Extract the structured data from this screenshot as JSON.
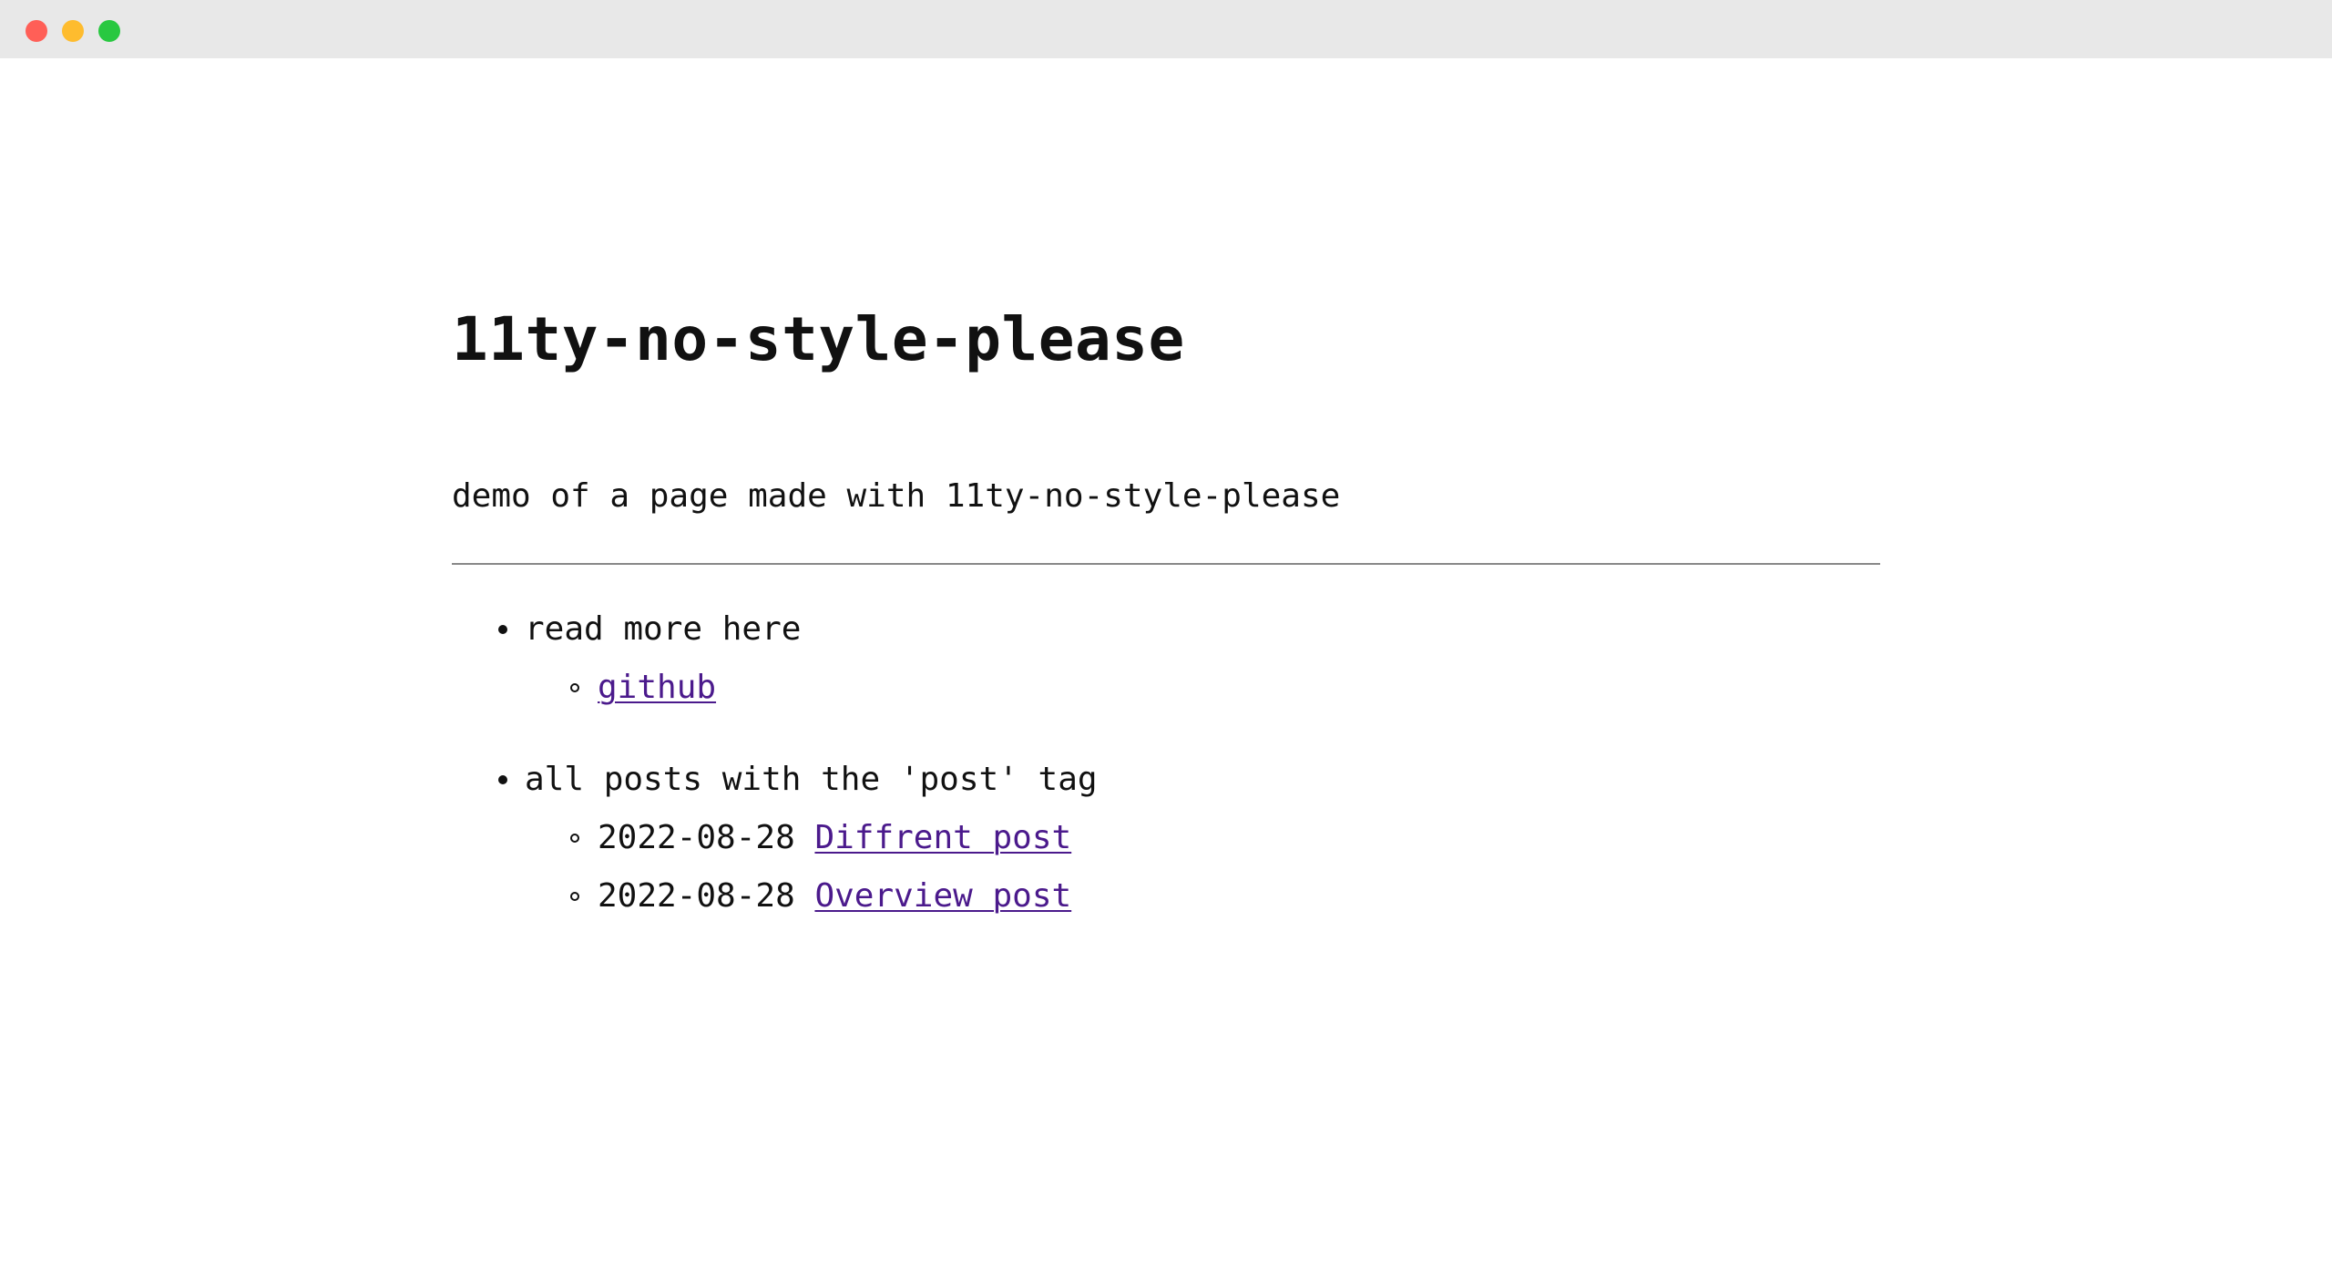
{
  "window": {
    "controls": [
      "close",
      "minimize",
      "maximize"
    ]
  },
  "page": {
    "title": "11ty-no-style-please",
    "subtitle": "demo of a page made with 11ty-no-style-please"
  },
  "sections": [
    {
      "label": "read more here",
      "items": [
        {
          "date": "",
          "link_text": "github"
        }
      ]
    },
    {
      "label": "all posts with the 'post' tag",
      "items": [
        {
          "date": "2022-08-28",
          "link_text": "Diffrent post"
        },
        {
          "date": "2022-08-28",
          "link_text": "Overview post"
        }
      ]
    }
  ],
  "colors": {
    "link": "#4b1a8c",
    "text": "#111111",
    "titlebar": "#e8e8e8"
  }
}
